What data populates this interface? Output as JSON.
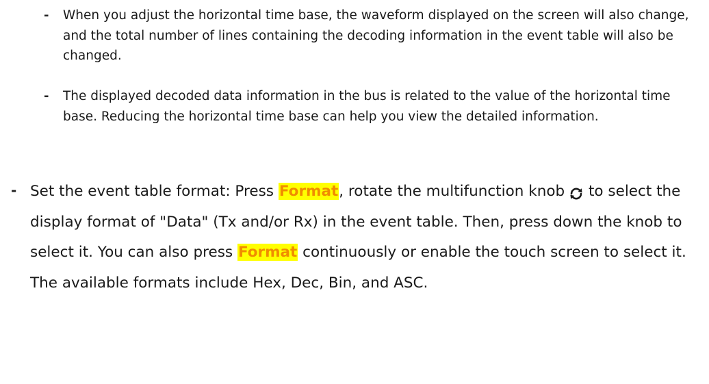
{
  "sub_bullets": [
    {
      "marker": "-",
      "text": "When you adjust the horizontal time base, the waveform displayed on the screen will also change, and the total number of lines containing the decoding information in the event table will also be changed."
    },
    {
      "marker": "-",
      "text": "The displayed decoded data information in the bus is related to the value of the horizontal time base. Reducing the horizontal time base can help you view the detailed information."
    }
  ],
  "main_bullet": {
    "marker": "-",
    "part1": "Set the event table format: Press ",
    "keyword1": "Format",
    "part2": ", rotate the multifunction knob",
    "knob_icon": "rotate-knob-icon",
    "part3": " to select the display format of \"Data\" (Tx and/or Rx) in the event table. Then, press down the knob to select it. You can also press ",
    "keyword2": "Format",
    "part4": " continuously or enable the touch screen to select it. The available formats include Hex, Dec, Bin, and ASC."
  },
  "colors": {
    "keyword_text": "#f08c00",
    "keyword_highlight": "#ffff00",
    "text": "#1a1a1a"
  }
}
